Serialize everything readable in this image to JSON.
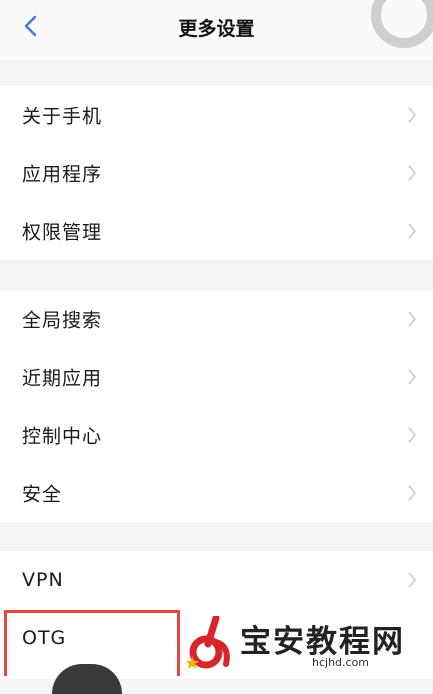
{
  "header": {
    "title": "更多设置",
    "back_icon": "chevron-left-icon"
  },
  "groups": [
    {
      "items": [
        {
          "label": "关于手机"
        },
        {
          "label": "应用程序"
        },
        {
          "label": "权限管理"
        }
      ]
    },
    {
      "items": [
        {
          "label": "全局搜索"
        },
        {
          "label": "近期应用"
        },
        {
          "label": "控制中心"
        },
        {
          "label": "安全"
        }
      ]
    },
    {
      "items": [
        {
          "label": "VPN"
        },
        {
          "label": "OTG"
        }
      ]
    }
  ],
  "watermark": {
    "text": "宝安教程网",
    "url": "hcjhd.com"
  },
  "colors": {
    "accent": "#3d7bd9",
    "highlight": "#e8453c",
    "logo_red": "#d8242a"
  }
}
